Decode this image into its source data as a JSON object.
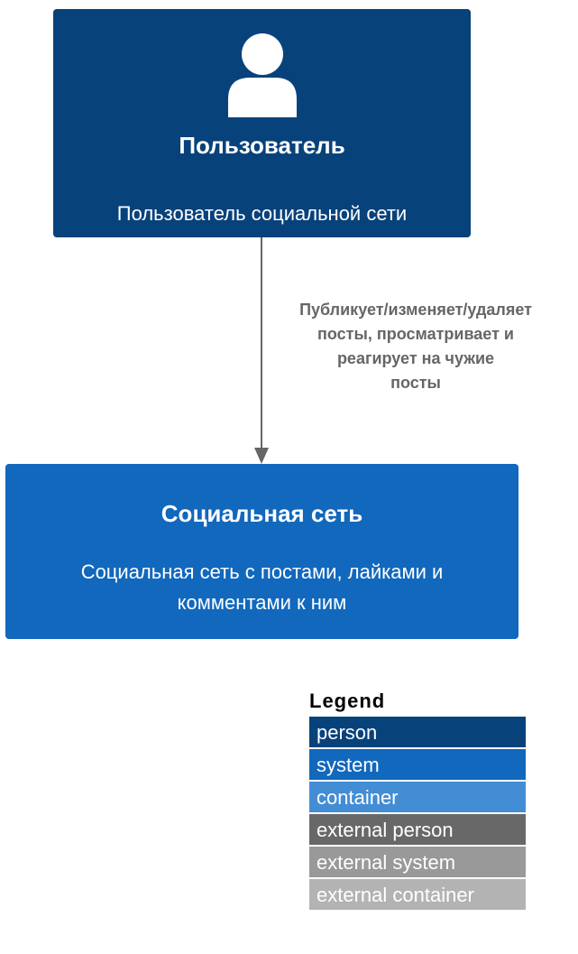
{
  "person": {
    "title": "Пользователь",
    "description": "Пользователь социальной сети",
    "icon": "person-icon",
    "color": "#08427b"
  },
  "system": {
    "title": "Социальная сеть",
    "description_lines": [
      "Социальная сеть с постами, лайками и",
      "комментами к ним"
    ],
    "color": "#1168bd"
  },
  "relationship": {
    "label_lines": [
      "Публикует/изменяет/удаляет",
      "посты, просматривает и",
      "реагирует на чужие",
      "посты"
    ],
    "color": "#666666"
  },
  "legend": {
    "title": "Legend",
    "items": [
      {
        "label": "person",
        "color": "#08427b"
      },
      {
        "label": "system",
        "color": "#1168bd"
      },
      {
        "label": "container",
        "color": "#438dd5"
      },
      {
        "label": "external person",
        "color": "#686868"
      },
      {
        "label": "external system",
        "color": "#999999"
      },
      {
        "label": "external container",
        "color": "#b3b3b3"
      }
    ]
  }
}
